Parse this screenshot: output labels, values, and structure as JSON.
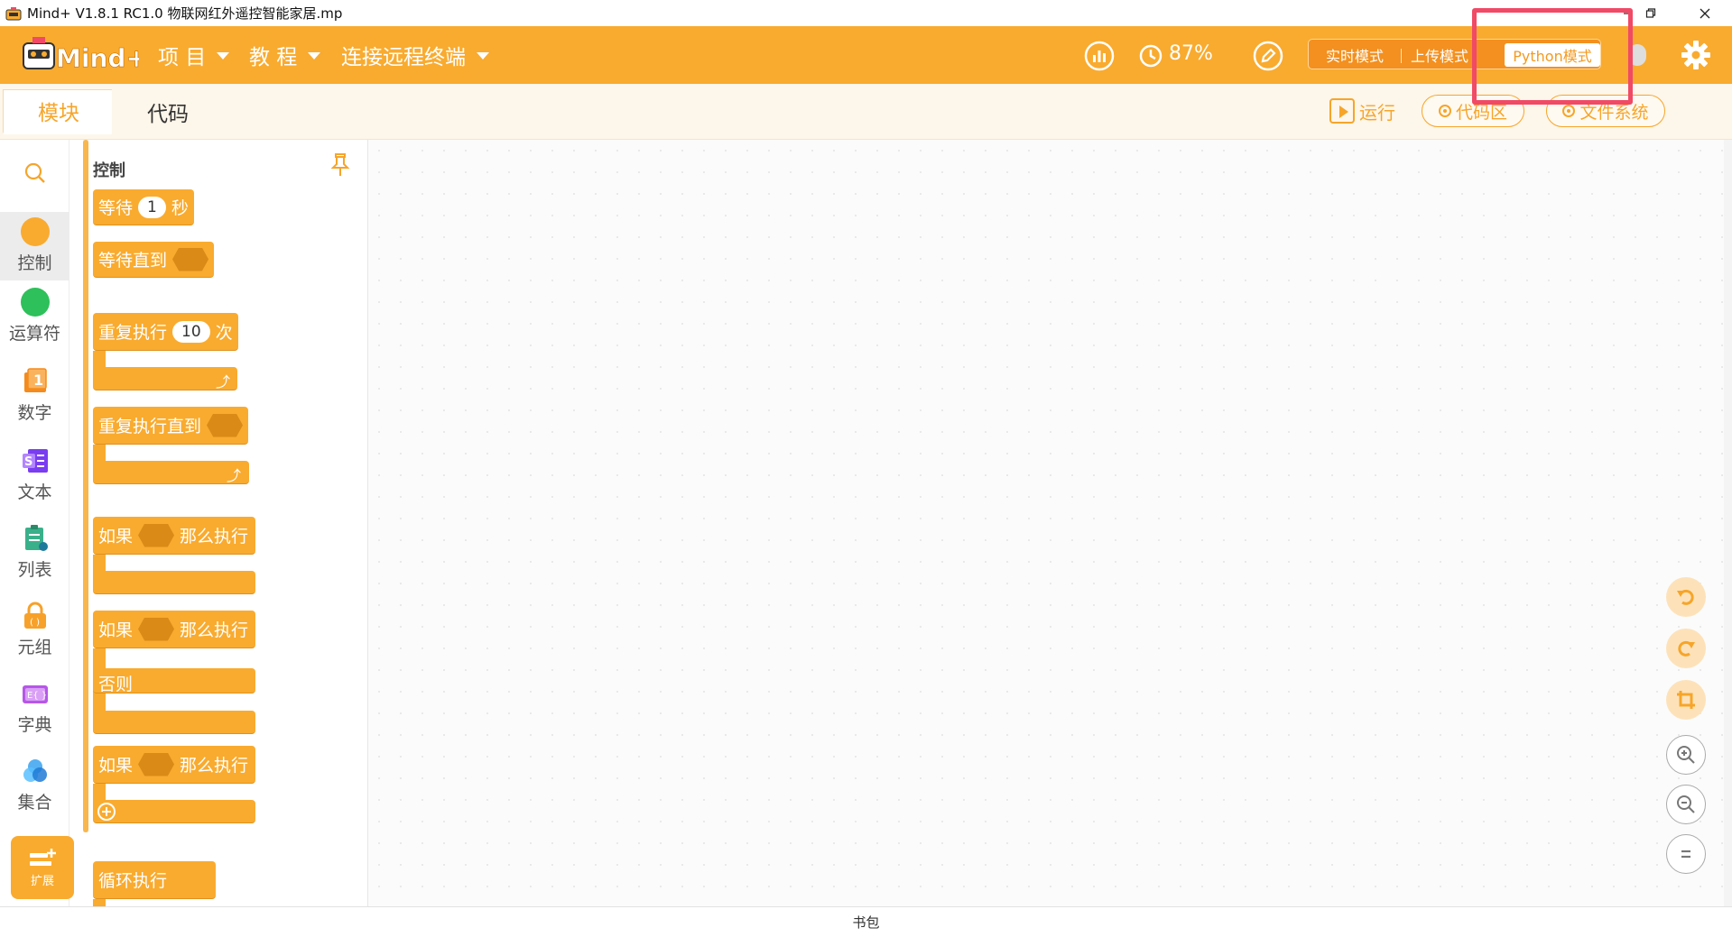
{
  "window": {
    "title": "Mind+ V1.8.1 RC1.0   物联网红外遥控智能家居.mp"
  },
  "menu": {
    "logo_text": "Mind+",
    "items": [
      {
        "label": "项 目"
      },
      {
        "label": "教 程"
      },
      {
        "label": "连接远程终端"
      }
    ],
    "battery_percent": "87%",
    "modes": [
      {
        "label": "实时模式"
      },
      {
        "label": "上传模式"
      },
      {
        "label": "Python模式"
      }
    ],
    "active_mode": "Python模式",
    "highlight_color": "#f04a66",
    "accent_color": "#f9ab2f"
  },
  "tabs": {
    "blocks": "模块",
    "code": "代码"
  },
  "toolbar": {
    "run": "运行",
    "code_area": "代码区",
    "file_system": "文件系统"
  },
  "categories": [
    {
      "label": "控制",
      "color": "#f9ab2f",
      "icon": "circle-icon"
    },
    {
      "label": "运算符",
      "color": "#2ec05a",
      "icon": "circle-icon"
    },
    {
      "label": "数字",
      "color": "#f58b1d",
      "icon": "number-icon"
    },
    {
      "label": "文本",
      "color": "#7a3df0",
      "icon": "text-icon"
    },
    {
      "label": "列表",
      "color": "#3ab08a",
      "icon": "list-icon"
    },
    {
      "label": "元组",
      "color": "#f7a12b",
      "icon": "tuple-icon"
    },
    {
      "label": "字典",
      "color": "#b657e8",
      "icon": "dict-icon"
    },
    {
      "label": "集合",
      "color": "#3aa2f0",
      "icon": "set-icon"
    }
  ],
  "extension_label": "扩展",
  "palette": {
    "title": "控制",
    "blocks": {
      "wait_pre": "等待",
      "wait_val": "1",
      "wait_post": "秒",
      "wait_until": "等待直到",
      "repeat_pre": "重复执行",
      "repeat_val": "10",
      "repeat_post": "次",
      "repeat_until": "重复执行直到",
      "if1_pre": "如果",
      "if1_post": "那么执行",
      "if2_pre": "如果",
      "if2_post": "那么执行",
      "else": "否则",
      "if3_pre": "如果",
      "if3_post": "那么执行",
      "forever": "循环执行"
    }
  },
  "bottom": {
    "backpack": "书包"
  }
}
